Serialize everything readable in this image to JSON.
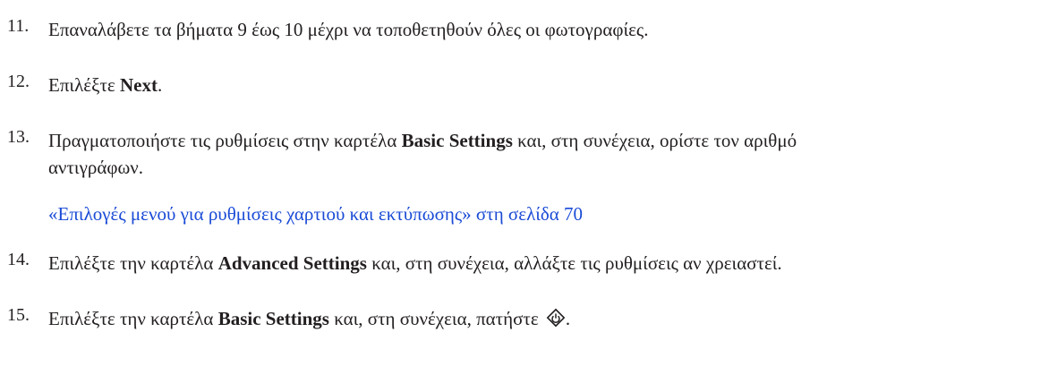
{
  "steps": [
    {
      "number": "11.",
      "text": "Επαναλάβετε τα βήματα 9 έως 10 μέχρι να τοποθετηθούν όλες οι φωτογραφίες."
    },
    {
      "number": "12.",
      "pre": "Επιλέξτε ",
      "bold": "Next",
      "post": "."
    },
    {
      "number": "13.",
      "pre": "Πραγματοποιήστε τις ρυθμίσεις στην καρτέλα ",
      "bold": "Basic Settings",
      "post": " και, στη συνέχεια, ορίστε τον αριθμό",
      "line2": "αντιγράφων.",
      "link": "«Επιλογές μενού για ρυθμίσεις χαρτιού και εκτύπωσης» στη σελίδα 70"
    },
    {
      "number": "14.",
      "pre": "Επιλέξτε την καρτέλα ",
      "bold": "Advanced Settings",
      "post": " και, στη συνέχεια, αλλάξτε τις ρυθμίσεις αν χρειαστεί."
    },
    {
      "number": "15.",
      "pre": "Επιλέξτε την καρτέλα ",
      "bold": "Basic Settings",
      "post": " και, στη συνέχεια, πατήστε ",
      "icon": "start-button-icon",
      "end": "."
    }
  ],
  "colors": {
    "text": "#231f20",
    "link": "#1a4bd6"
  }
}
